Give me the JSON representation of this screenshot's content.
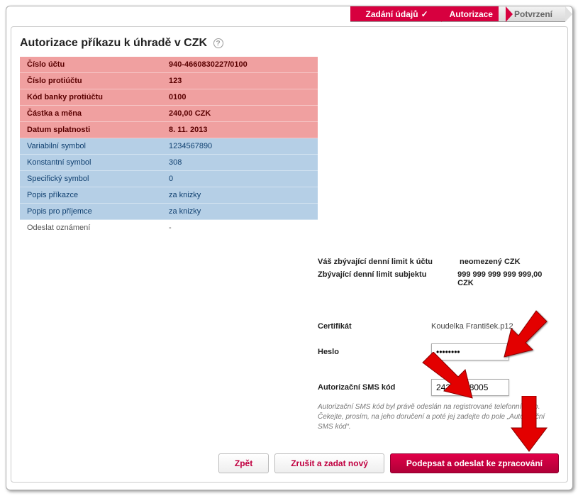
{
  "steps": {
    "done": "Zadání údajů",
    "current": "Autorizace",
    "upcoming": "Potvrzení"
  },
  "title": "Autorizace příkazu k úhradě v CZK",
  "details": {
    "red": [
      {
        "label": "Číslo účtu",
        "value": "940-4660830227/0100"
      },
      {
        "label": "Číslo protiúčtu",
        "value": "123"
      },
      {
        "label": "Kód banky protiúčtu",
        "value": "0100"
      },
      {
        "label": "Částka a měna",
        "value": "240,00 CZK"
      },
      {
        "label": "Datum splatnosti",
        "value": "8. 11. 2013"
      }
    ],
    "blue": [
      {
        "label": "Variabilní symbol",
        "value": "1234567890"
      },
      {
        "label": "Konstantní symbol",
        "value": "308"
      },
      {
        "label": "Specifický symbol",
        "value": "0"
      },
      {
        "label": "Popis příkazce",
        "value": "za knizky"
      },
      {
        "label": "Popis pro příjemce",
        "value": "za knizky"
      }
    ],
    "plain": [
      {
        "label": "Odeslat oznámení",
        "value": "-"
      }
    ]
  },
  "limits": {
    "row1": {
      "k": "Váš zbývající denní limit k účtu",
      "v": "neomezený CZK"
    },
    "row2": {
      "k": "Zbývající denní limit subjektu",
      "v": "999 999 999 999 999,00 CZK"
    }
  },
  "auth": {
    "cert_label": "Certifikát",
    "cert_value": "Koudelka František.p12",
    "pwd_label": "Heslo",
    "pwd_value": "••••••••",
    "sms_label": "Autorizační SMS kód",
    "sms_value": "242 175 8005",
    "hint": "Autorizační SMS kód byl právě odeslán na registrované telefonní číslo. Čekejte, prosím, na jeho doručení a poté jej zadejte do pole „Autorizační SMS kód“."
  },
  "buttons": {
    "back": "Zpět",
    "cancel": "Zrušit a zadat nový",
    "submit": "Podepsat a odeslat ke zpracování"
  }
}
